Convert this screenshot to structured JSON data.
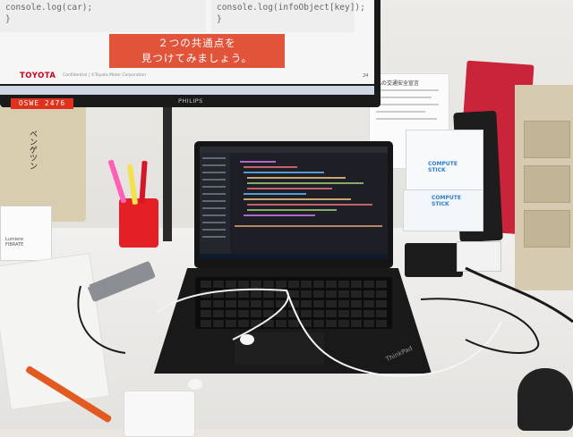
{
  "monitor": {
    "code_left": "console.log(car);\n}",
    "code_right": "console.log(infoObject[key]);\n}",
    "banner_line1": "２つの共通点を",
    "banner_line2": "見つけてみましょう。",
    "footer_logo": "TOYOTA",
    "footer_confidential": "Confidential | ©Toyota Motor Corporation",
    "page_number": "24",
    "brand": "PHILIPS",
    "asset_tag": "OSWE 2476"
  },
  "tote_bag": {
    "text": "ベンゲツン"
  },
  "poster": {
    "title": "私の交通安全宣言"
  },
  "boxes": {
    "compute_stick_top": "COMPUTE\nSTICK",
    "compute_stick_bottom": "COMPUTE\nSTICK"
  },
  "left_box": {
    "text": "Lumiere\nFIBRATE"
  },
  "laptop": {
    "brand": "ThinkPad"
  },
  "colors": {
    "banner": "#e1543a",
    "asset_sticker": "#e0311d",
    "pen_cup": "#e41f26",
    "ide_background": "#1e1f26"
  }
}
